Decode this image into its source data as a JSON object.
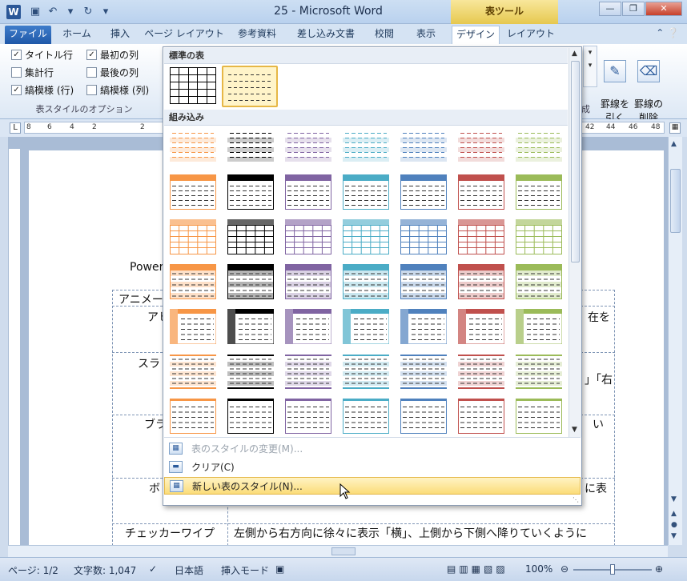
{
  "window": {
    "title": "25 - Microsoft Word",
    "context_tab_group": "表ツール",
    "controls": [
      "minimize",
      "restore",
      "close"
    ]
  },
  "ribbon": {
    "tabs": [
      {
        "label": "ファイル",
        "state": "file"
      },
      {
        "label": "ホーム"
      },
      {
        "label": "挿入"
      },
      {
        "label": "ページ レイアウト"
      },
      {
        "label": "参考資料"
      },
      {
        "label": "差し込み文書"
      },
      {
        "label": "校閲"
      },
      {
        "label": "表示"
      },
      {
        "label": "デザイン",
        "state": "active"
      },
      {
        "label": "レイアウト"
      }
    ],
    "style_options": {
      "group_label": "表スタイルのオプション",
      "header_row": {
        "label": "タイトル行",
        "checked": true
      },
      "first_column": {
        "label": "最初の列",
        "checked": true
      },
      "total_row": {
        "label": "集計行",
        "checked": false
      },
      "last_column": {
        "label": "最後の列",
        "checked": false
      },
      "banded_rows": {
        "label": "縞模様 (行)",
        "checked": true
      },
      "banded_columns": {
        "label": "縞模様 (列)",
        "checked": false
      }
    },
    "draw_borders": {
      "draw_table": "罫線を\n引く",
      "eraser": "罫線の\n削除",
      "group_label_partial": "成"
    }
  },
  "ruler": {
    "ticks": [
      "8",
      "6",
      "4",
      "2",
      "2",
      "42",
      "44",
      "46",
      "48"
    ]
  },
  "document": {
    "text_fragments": [
      {
        "id": "power",
        "text": "Power"
      },
      {
        "id": "anime",
        "text": "アニメー"
      },
      {
        "id": "appear",
        "text": "アヒ"
      },
      {
        "id": "slide",
        "text": "スラ"
      },
      {
        "id": "blinds",
        "text": "ブラ"
      },
      {
        "id": "box",
        "text": "ボ"
      },
      {
        "id": "exist",
        "text": "在を"
      },
      {
        "id": "right",
        "text": "」「右"
      },
      {
        "id": "ii",
        "text": "い"
      },
      {
        "id": "nihyo",
        "text": "に表"
      },
      {
        "id": "checker",
        "text": "チェッカーワイプ"
      },
      {
        "id": "checker_desc",
        "text": "左側から右方向に徐々に表示「横」、上側から下側へ降りていくように"
      }
    ]
  },
  "gallery": {
    "section_plain": "標準の表",
    "section_builtin": "組み込み",
    "color_columns": [
      "#f79646",
      "#000000",
      "#8064a2",
      "#4bacc6",
      "#4f81bd",
      "#c0504d",
      "#9bbb59"
    ],
    "row_styles": [
      "light-shading",
      "light-list",
      "light-grid",
      "medium-shading-1",
      "medium-shading-2",
      "medium-list-1",
      "medium-list-2"
    ],
    "menu": [
      {
        "label": "表のスタイルの変更(M)...",
        "state": "disabled",
        "icon": "modify-table-style-icon"
      },
      {
        "label": "クリア(C)",
        "state": "normal",
        "icon": "clear-table-style-icon"
      },
      {
        "label": "新しい表のスタイル(N)...",
        "state": "hover",
        "icon": "new-table-style-icon"
      }
    ]
  },
  "statusbar": {
    "page": "ページ: 1/2",
    "words": "文字数: 1,047",
    "language": "日本語",
    "mode": "挿入モード",
    "zoom": "100%"
  }
}
